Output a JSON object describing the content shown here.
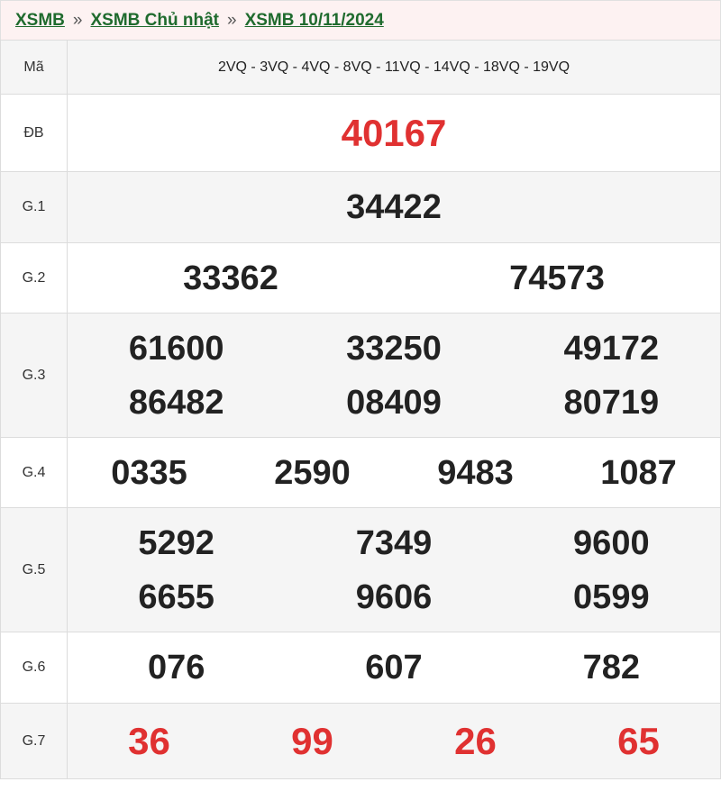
{
  "breadcrumb": {
    "items": [
      "XSMB",
      "XSMB Chủ nhật",
      "XSMB 10/11/2024"
    ],
    "separator": "»"
  },
  "codes": {
    "label": "Mã",
    "value": "2VQ - 3VQ - 4VQ - 8VQ - 11VQ - 14VQ - 18VQ - 19VQ"
  },
  "prizes": {
    "db": {
      "label": "ĐB",
      "numbers": [
        "40167"
      ]
    },
    "g1": {
      "label": "G.1",
      "numbers": [
        "34422"
      ]
    },
    "g2": {
      "label": "G.2",
      "numbers": [
        "33362",
        "74573"
      ]
    },
    "g3": {
      "label": "G.3",
      "numbers": [
        "61600",
        "33250",
        "49172",
        "86482",
        "08409",
        "80719"
      ]
    },
    "g4": {
      "label": "G.4",
      "numbers": [
        "0335",
        "2590",
        "9483",
        "1087"
      ]
    },
    "g5": {
      "label": "G.5",
      "numbers": [
        "5292",
        "7349",
        "9600",
        "6655",
        "9606",
        "0599"
      ]
    },
    "g6": {
      "label": "G.6",
      "numbers": [
        "076",
        "607",
        "782"
      ]
    },
    "g7": {
      "label": "G.7",
      "numbers": [
        "36",
        "99",
        "26",
        "65"
      ]
    }
  },
  "colors": {
    "link_green": "#1f6b2e",
    "highlight_red": "#e03131",
    "text": "#222222"
  }
}
